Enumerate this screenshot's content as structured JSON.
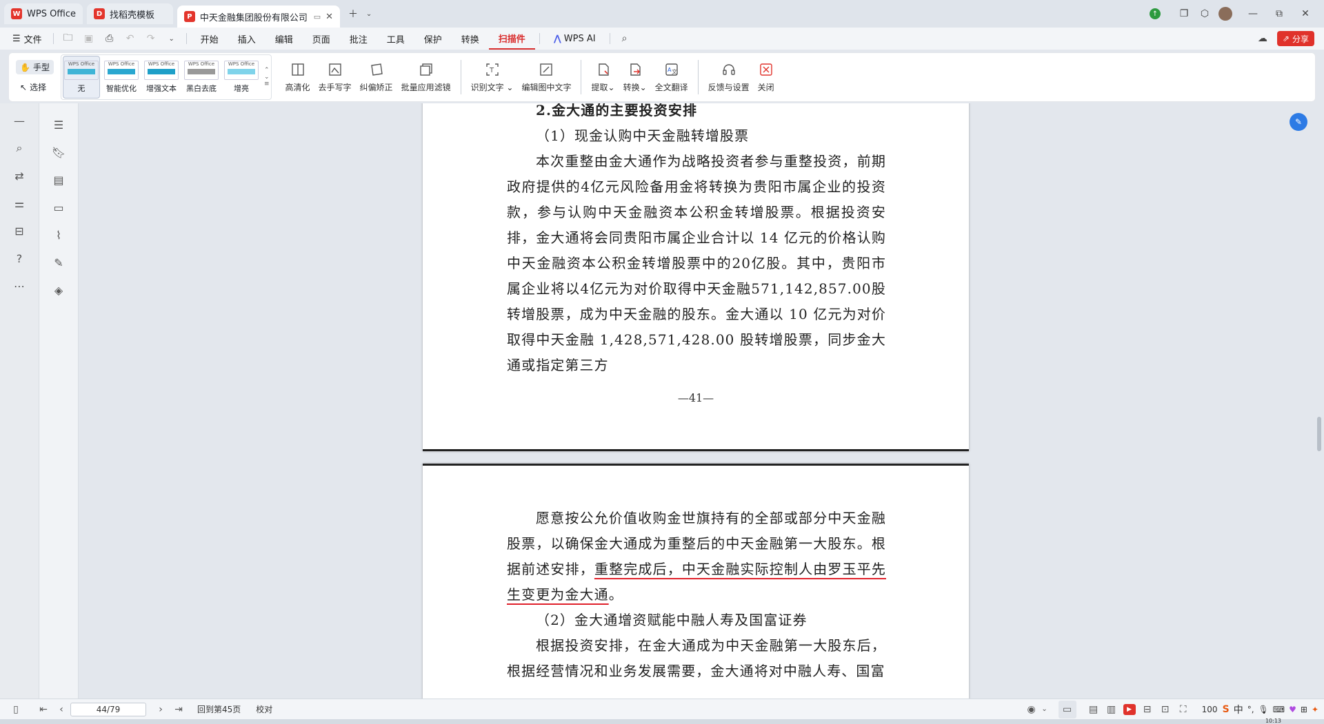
{
  "tabs": [
    {
      "label": "WPS Office",
      "logo": "W",
      "logo_color": "#e3352c"
    },
    {
      "label": "找稻壳模板",
      "logo": "D",
      "logo_color": "#e3352c"
    },
    {
      "label": "中天金融集团股份有限公司",
      "logo": "P",
      "logo_color": "#e3352c"
    }
  ],
  "menu": {
    "file": "文件",
    "items": [
      "开始",
      "插入",
      "编辑",
      "页面",
      "批注",
      "工具",
      "保护",
      "转换",
      "扫描件"
    ],
    "active": "扫描件",
    "ai": "WPS AI",
    "share": "分享"
  },
  "ribbon": {
    "hand": "手型",
    "select": "选择",
    "filters": [
      {
        "label": "无",
        "thumb": "WPS Office"
      },
      {
        "label": "智能优化",
        "thumb": "WPS Office"
      },
      {
        "label": "增强文本",
        "thumb": "WPS Office"
      },
      {
        "label": "黑白去底",
        "thumb": "WPS Office"
      },
      {
        "label": "增亮",
        "thumb": "WPS Office"
      }
    ],
    "tools": [
      "高清化",
      "去手写字",
      "纠偏矫正",
      "批量应用滤镜"
    ],
    "ocr": [
      "识别文字",
      "编辑图中文字"
    ],
    "convert": [
      "提取",
      "转换",
      "全文翻译"
    ],
    "misc": [
      "反馈与设置",
      "关闭"
    ]
  },
  "document": {
    "page1": {
      "heading": "2.金大通的主要投资安排",
      "sub": "（1）现金认购中天金融转增股票",
      "para": "本次重整由金大通作为战略投资者参与重整投资，前期政府提供的4亿元风险备用金将转换为贵阳市属企业的投资款，参与认购中天金融资本公积金转增股票。根据投资安排，金大通将会同贵阳市属企业合计以 14 亿元的价格认购中天金融资本公积金转增股票中的20亿股。其中，贵阳市属企业将以4亿元为对价取得中天金融571,142,857.00股转增股票，成为中天金融的股东。金大通以 10 亿元为对价取得中天金融 1,428,571,428.00 股转增股票，同步金大通或指定第三方",
      "page_number": "—41—"
    },
    "page2": {
      "para_a": "愿意按公允价值收购金世旗持有的全部或部分中天金融股票，以确保金大通成为重整后的中天金融第一大股东。根据前述安排，",
      "para_underlined": "重整完成后，中天金融实际控制人由罗玉平先生变更为金大通",
      "para_end": "。",
      "sub2": "（2）金大通增资赋能中融人寿及国富证券",
      "para2": "根据投资安排，在金大通成为中天金融第一大股东后，根据经营情况和业务发展需要，金大通将对中融人寿、国富"
    }
  },
  "status": {
    "page_input": "44/79",
    "back": "回到第45页",
    "proof": "校对",
    "zoom": "100",
    "ime": "中",
    "time": "10:13"
  },
  "colors": {
    "accent": "#d92e2e",
    "underline": "#e0202a"
  }
}
